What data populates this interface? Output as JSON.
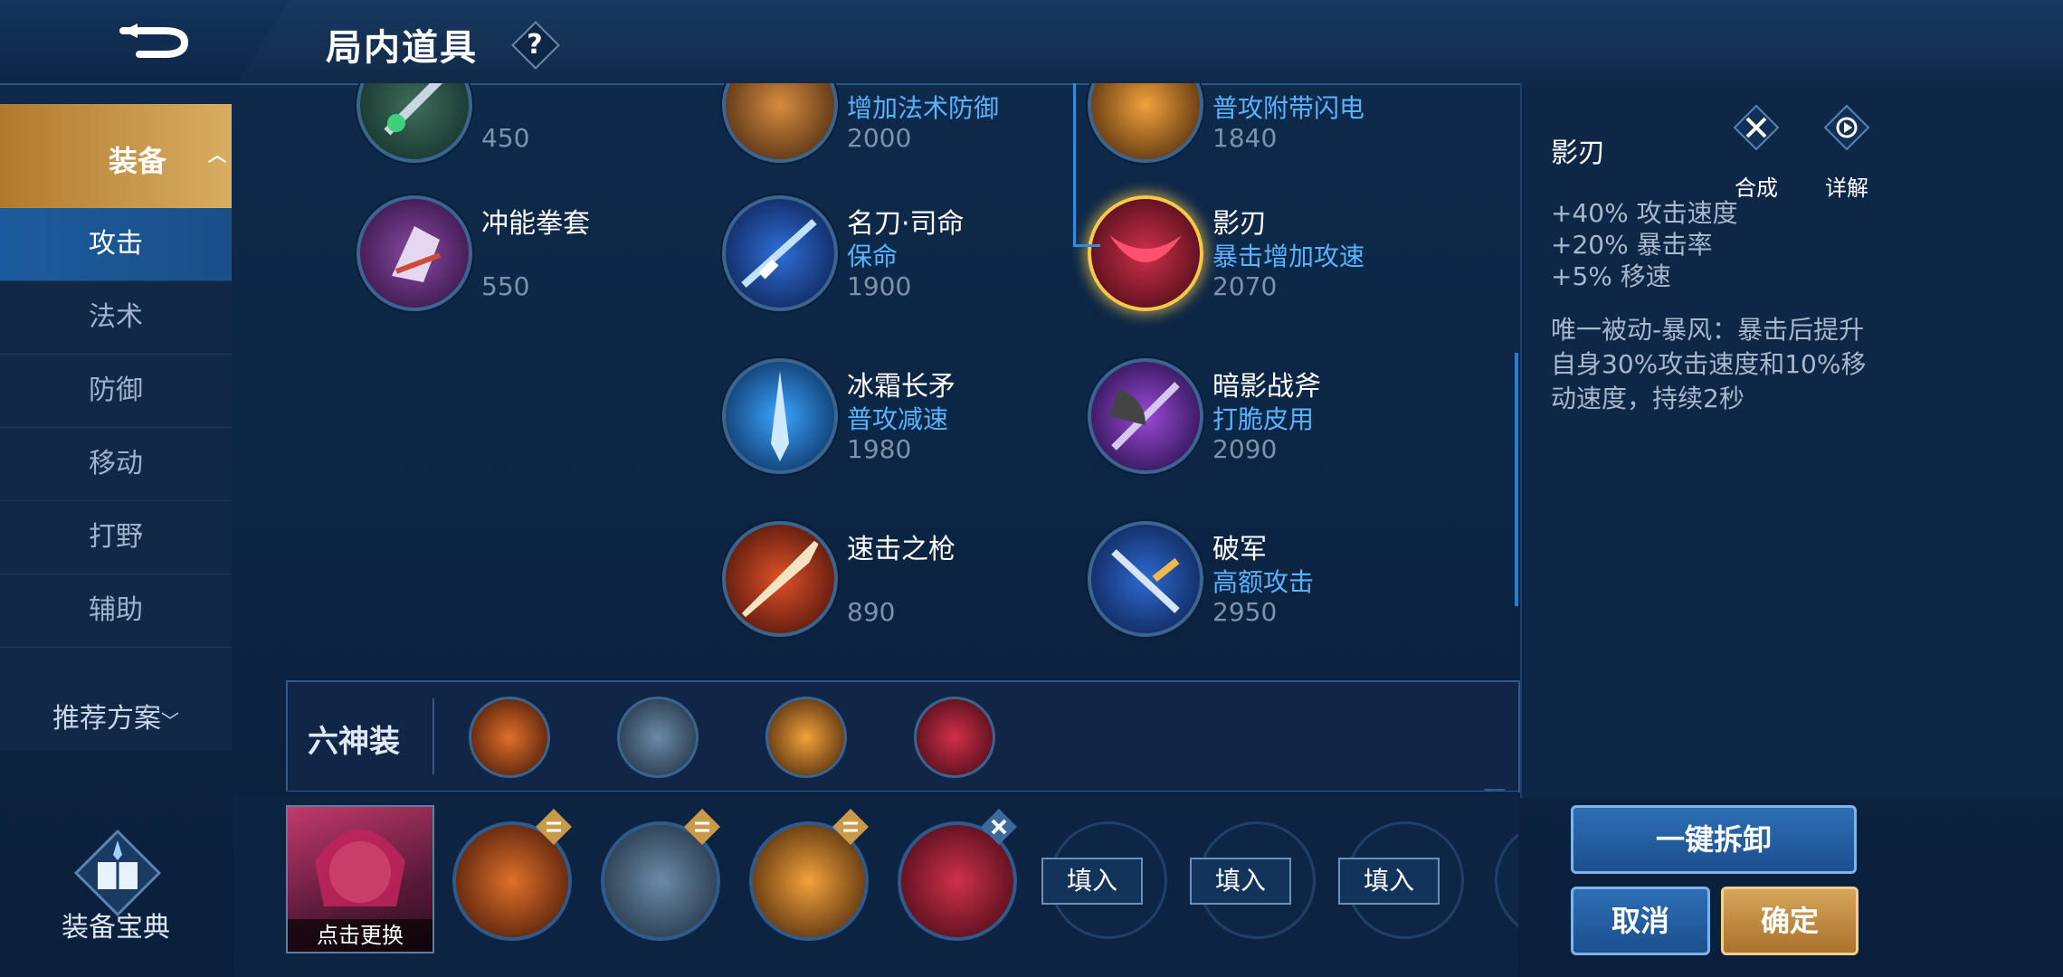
{
  "header": {
    "title": "局内道具",
    "help_glyph": "?",
    "back_icon": "back-arrow-icon"
  },
  "sidebar": {
    "main_label": "装备",
    "categories": [
      "攻击",
      "法术",
      "防御",
      "移动",
      "打野",
      "辅助"
    ],
    "active_category": "攻击",
    "recommend_label": "推荐方案",
    "codex_label": "装备宝典"
  },
  "items": [
    {
      "name": "",
      "desc": "",
      "price": "450"
    },
    {
      "name": "",
      "desc": "增加法术防御",
      "price": "2000"
    },
    {
      "name": "",
      "desc": "普攻附带闪电",
      "price": "1840"
    },
    {
      "name": "冲能拳套",
      "desc": "",
      "price": "550"
    },
    {
      "name": "名刀·司命",
      "desc": "保命",
      "price": "1900"
    },
    {
      "name": "影刃",
      "desc": "暴击增加攻速",
      "price": "2070"
    },
    {
      "name": "冰霜长矛",
      "desc": "普攻减速",
      "price": "1980"
    },
    {
      "name": "暗影战斧",
      "desc": "打脆皮用",
      "price": "2090"
    },
    {
      "name": "速击之枪",
      "desc": "",
      "price": "890"
    },
    {
      "name": "破军",
      "desc": "高额攻击",
      "price": "2950"
    }
  ],
  "six_god_set": {
    "label": "六神装",
    "slot_icons": [
      "sword-red-icon",
      "boots-icon",
      "golden-blade-icon",
      "shadow-blade-icon"
    ]
  },
  "loadout": {
    "hero_change_label": "点击更换",
    "fill_label": "填入",
    "equipped_icons": [
      "sword-red-icon",
      "boots-icon",
      "golden-blade-icon",
      "shadow-blade-icon"
    ]
  },
  "detail": {
    "name": "影刃",
    "compose_label": "合成",
    "details_label": "详解",
    "stats": [
      "+40% 攻击速度",
      "+20% 暴击率",
      "+5% 移速"
    ],
    "passive": "唯一被动-暴风：暴击后提升自身30%攻击速度和10%移动速度，持续2秒"
  },
  "buttons": {
    "dismantle": "一键拆卸",
    "cancel": "取消",
    "confirm": "确定"
  },
  "colors": {
    "accent_blue": "#59b3ff",
    "gold": "#d6a55a",
    "bg": "#0c2544"
  }
}
